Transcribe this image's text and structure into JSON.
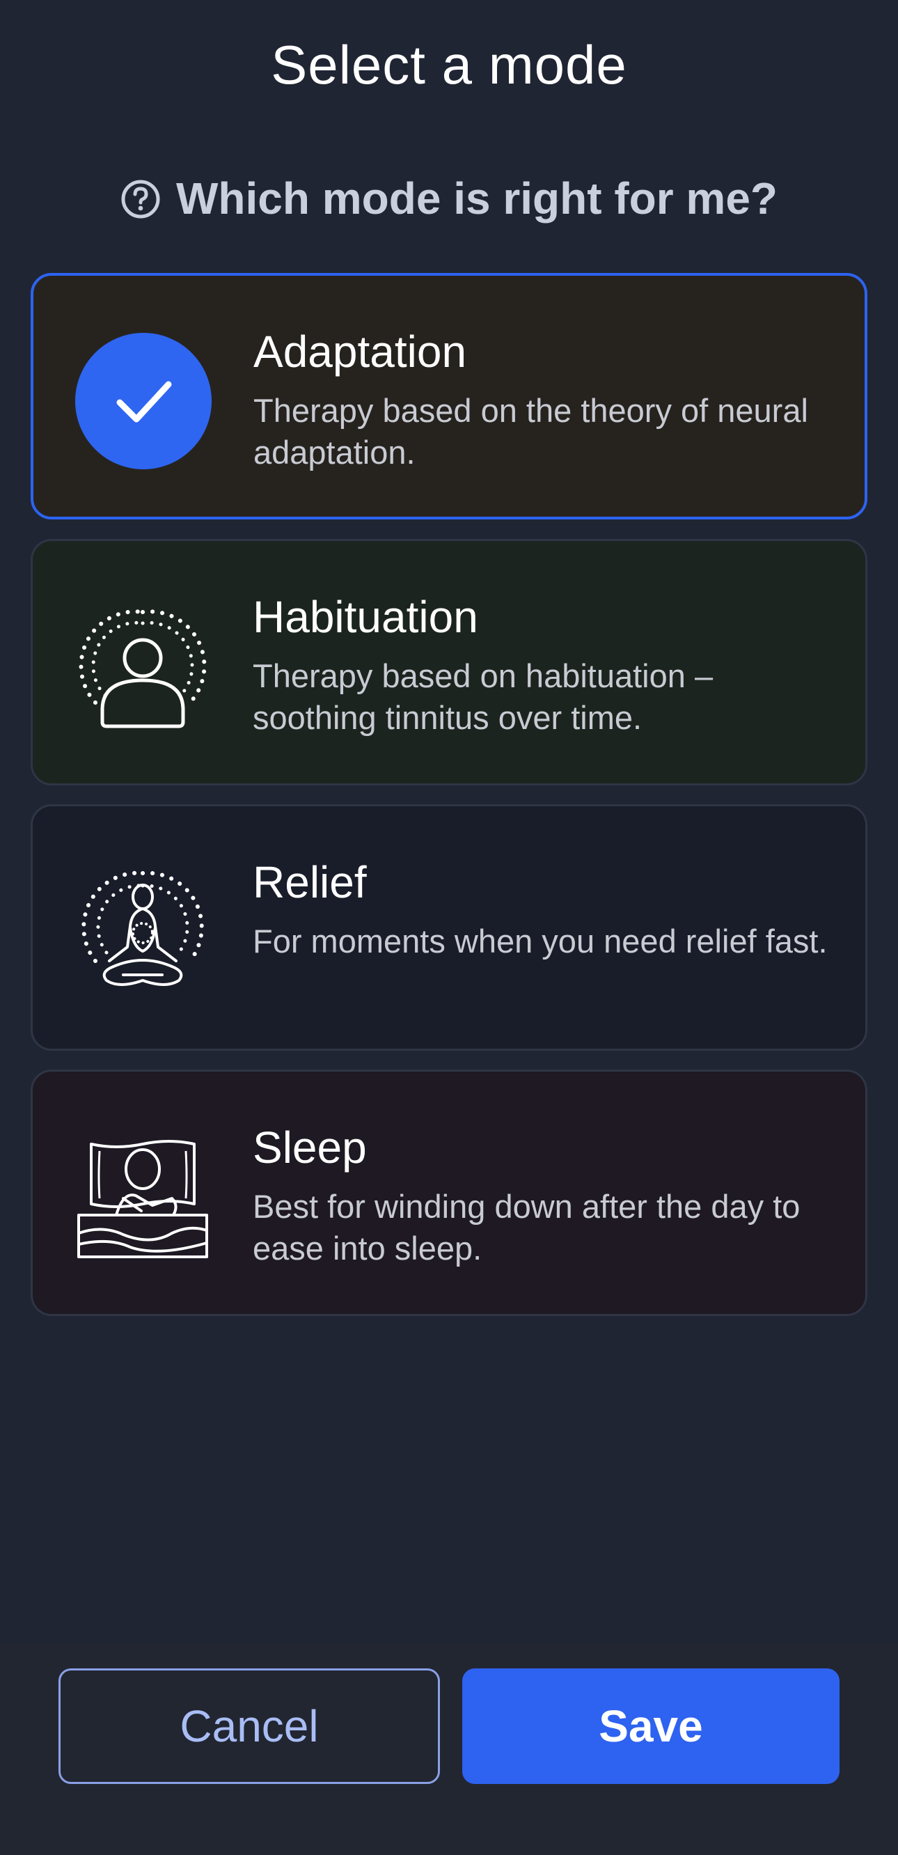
{
  "header": {
    "title": "Select a mode"
  },
  "help": {
    "label": "Which mode is right for me?",
    "icon": "question-circle-icon"
  },
  "modes": [
    {
      "name": "Adaptation",
      "description": "Therapy based on the theory of neural adaptation.",
      "icon": "checkmark-icon",
      "selected": true
    },
    {
      "name": "Habituation",
      "description": "Therapy based on habituation – soothing tinnitus over time.",
      "icon": "person-aura-icon",
      "selected": false
    },
    {
      "name": "Relief",
      "description": "For moments when you need relief fast.",
      "icon": "meditation-icon",
      "selected": false
    },
    {
      "name": "Sleep",
      "description": "Best for winding down after the day to ease into sleep.",
      "icon": "sleeping-person-icon",
      "selected": false
    }
  ],
  "actions": {
    "cancel_label": "Cancel",
    "save_label": "Save"
  },
  "colors": {
    "accent": "#2e66f2",
    "background": "#1f2533",
    "cancel_text": "#a9bdf5"
  }
}
